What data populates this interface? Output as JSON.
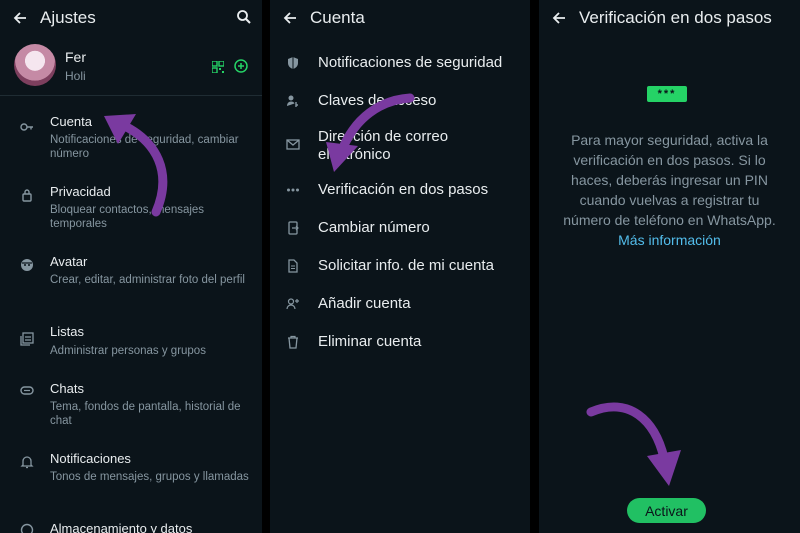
{
  "colors": {
    "background": "#0b141a",
    "text_primary": "#e9edef",
    "text_secondary": "#8696a0",
    "accent": "#25d366",
    "link": "#53bdeb",
    "annotation_arrow": "#7a3aa0"
  },
  "settings": {
    "title": "Ajustes",
    "profile": {
      "name": "Fer",
      "status": "Holi"
    },
    "items": [
      {
        "icon": "key-icon",
        "title": "Cuenta",
        "subtitle": "Notificaciones de seguridad, cambiar número"
      },
      {
        "icon": "lock-icon",
        "title": "Privacidad",
        "subtitle": "Bloquear contactos, mensajes temporales"
      },
      {
        "icon": "avatar-face-icon",
        "title": "Avatar",
        "subtitle": "Crear, editar, administrar foto del perfil"
      },
      {
        "icon": "lists-icon",
        "title": "Listas",
        "subtitle": "Administrar personas y grupos"
      },
      {
        "icon": "chat-icon",
        "title": "Chats",
        "subtitle": "Tema, fondos de pantalla, historial de chat"
      },
      {
        "icon": "bell-icon",
        "title": "Notificaciones",
        "subtitle": "Tonos de mensajes, grupos y llamadas"
      },
      {
        "icon": "storage-icon",
        "title": "Almacenamiento y datos",
        "subtitle": ""
      }
    ]
  },
  "account": {
    "title": "Cuenta",
    "items": [
      {
        "icon": "shield-icon",
        "label": "Notificaciones de seguridad"
      },
      {
        "icon": "passkey-icon",
        "label": "Claves de acceso"
      },
      {
        "icon": "mail-icon",
        "label": "Dirección de correo electrónico"
      },
      {
        "icon": "dots-icon",
        "label": "Verificación en dos pasos"
      },
      {
        "icon": "change-number-icon",
        "label": "Cambiar número"
      },
      {
        "icon": "document-icon",
        "label": "Solicitar info. de mi cuenta"
      },
      {
        "icon": "add-person-icon",
        "label": "Añadir cuenta"
      },
      {
        "icon": "trash-icon",
        "label": "Eliminar cuenta"
      }
    ]
  },
  "two_step": {
    "title": "Verificación en dos pasos",
    "pin_graphic": "***",
    "description": "Para mayor seguridad, activa la verificación en dos pasos. Si lo haces, deberás ingresar un PIN cuando vuelvas a registrar tu número de teléfono en WhatsApp.",
    "link": "Más información",
    "button": "Activar"
  }
}
